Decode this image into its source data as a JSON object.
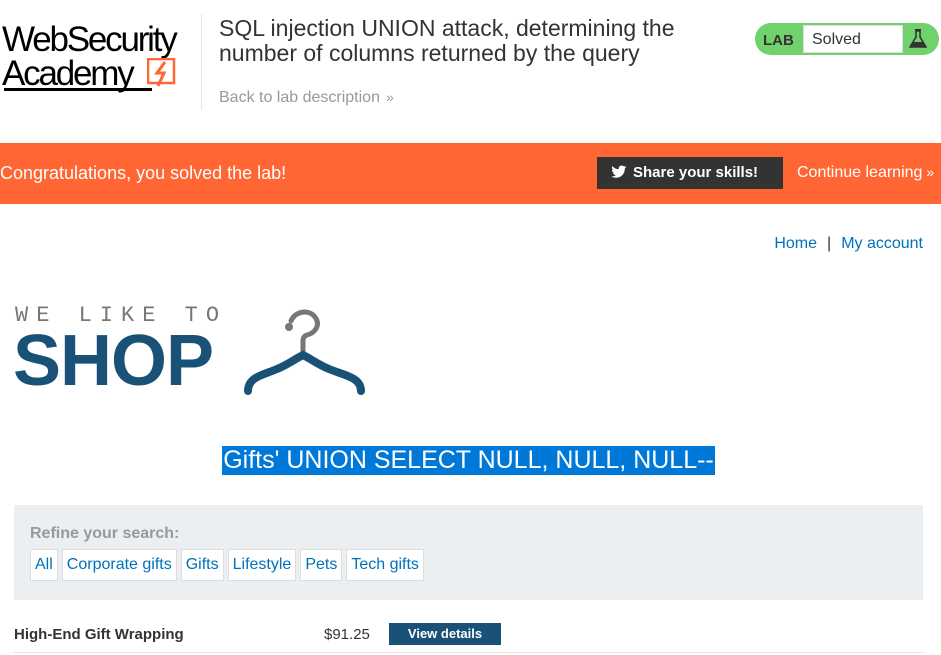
{
  "academy": {
    "logo_line1": "WebSecurity",
    "logo_line2": "Academy",
    "lab_title": "SQL injection UNION attack, determining the number of columns returned by the query",
    "back_link": "Back to lab description",
    "status_tag": "LAB",
    "status_value": "Solved"
  },
  "banner": {
    "message": "Congratulations, you solved the lab!",
    "share_label": "Share your skills!",
    "continue_label": "Continue learning"
  },
  "nav": {
    "home": "Home",
    "separator": "|",
    "account": "My account"
  },
  "shop_logo": {
    "tagline": "WE LIKE TO",
    "word": "SHOP"
  },
  "search": {
    "heading": "Gifts' UNION SELECT NULL, NULL, NULL--"
  },
  "filters": {
    "label": "Refine your search:",
    "items": [
      "All",
      "Corporate gifts",
      "Gifts",
      "Lifestyle",
      "Pets",
      "Tech gifts"
    ]
  },
  "products": [
    {
      "name": "High-End Gift Wrapping",
      "price": "$91.25",
      "button": "View details"
    }
  ],
  "colors": {
    "banner": "#ff6633",
    "status_pill": "#70d16d",
    "link": "#0071bc",
    "shop_brand": "#1a5277",
    "selection": "#0078d7",
    "filter_panel": "#ebeff2"
  },
  "icons": {
    "back_chevron": "double-chevron-right-icon",
    "flask": "flask-icon",
    "share": "twitter-bird-icon",
    "hanger": "clothes-hanger-icon"
  }
}
